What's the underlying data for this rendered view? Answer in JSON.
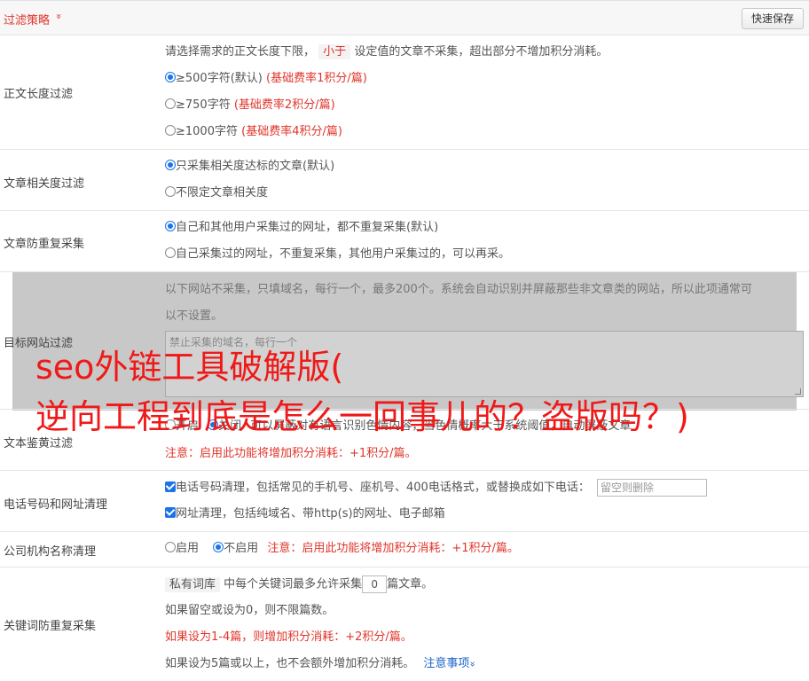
{
  "header": {
    "title": "过滤策略",
    "chevron": "»",
    "save_label": "快速保存"
  },
  "length_filter": {
    "label": "正文长度过滤",
    "desc_pre": "请选择需求的正文长度下限，",
    "desc_tag": "小于",
    "desc_post": "设定值的文章不采集，超出部分不增加积分消耗。",
    "options": [
      {
        "text": "≥500字符(默认)",
        "note": "(基础费率1积分/篇)",
        "checked": true
      },
      {
        "text": "≥750字符",
        "note": "(基础费率2积分/篇)",
        "checked": false
      },
      {
        "text": "≥1000字符",
        "note": "(基础费率4积分/篇)",
        "checked": false
      }
    ]
  },
  "relevance_filter": {
    "label": "文章相关度过滤",
    "options": [
      {
        "text": "只采集相关度达标的文章(默认)",
        "checked": true
      },
      {
        "text": "不限定文章相关度",
        "checked": false
      }
    ]
  },
  "dedup": {
    "label": "文章防重复采集",
    "options": [
      {
        "text": "自己和其他用户采集过的网址，都不重复采集(默认)",
        "checked": true
      },
      {
        "text": "自己采集过的网址，不重复采集，其他用户采集过的，可以再采。",
        "checked": false
      }
    ]
  },
  "site_filter": {
    "label": "目标网站过滤",
    "desc_line1": "以下网站不采集，只填域名，每行一个，最多200个。系统会自动识别并屏蔽那些非文章类的网站，所以此项通常可",
    "desc_line2": "以不设置。",
    "placeholder": "禁止采集的域名，每行一个"
  },
  "porn_filter": {
    "label": "文本鉴黄过滤",
    "opt_on": "开启",
    "opt_off": "关闭",
    "desc": "可以屏蔽对有语言识别色情内容，当色情概率大于系统阈值，自动屏蔽文章",
    "note": "注意：启用此功能将增加积分消耗：+1积分/篇。"
  },
  "phone_filter": {
    "label": "电话号码和网址清理",
    "phone_text": "电话号码清理，包括常见的手机号、座机号、400电话格式，或替换成如下电话：",
    "phone_placeholder": "留空则删除",
    "url_text": "网址清理，包括纯域名、带http(s)的网址、电子邮箱"
  },
  "company_filter": {
    "label": "公司机构名称清理",
    "opt_on": "启用",
    "opt_off": "不启用",
    "note": "注意：启用此功能将增加积分消耗：+1积分/篇。"
  },
  "keyword_dedup": {
    "label": "关键词防重复采集",
    "tag": "私有词库",
    "line1_pre": "中每个关键词最多允许采集",
    "value": "0",
    "line1_post": "篇文章。",
    "line2": "如果留空或设为0，则不限篇数。",
    "line3": "如果设为1-4篇，则增加积分消耗：+2积分/篇。",
    "line4": "如果设为5篇或以上，也不会额外增加积分消耗。",
    "notes_link": "注意事项",
    "notes_chevron": "»"
  },
  "watermark": {
    "line1": "seo外链工具破解版(",
    "line2": "逆向工程到底是怎么一回事儿的？盗版吗？)"
  },
  "colors": {
    "accent_red": "#e0352b",
    "accent_blue": "#1a73e8",
    "watermark_red": "#f01818"
  }
}
